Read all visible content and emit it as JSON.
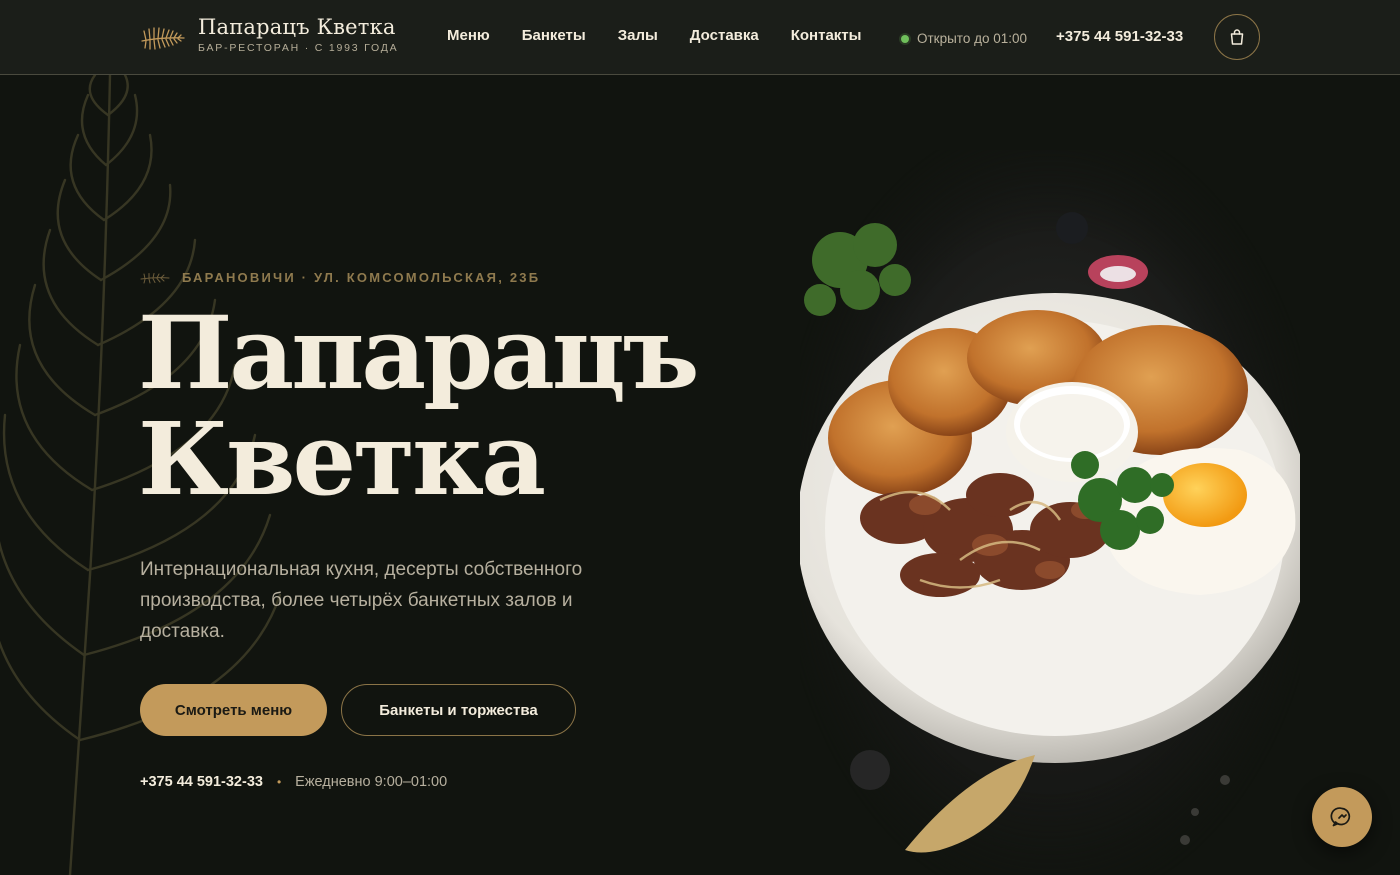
{
  "brand": {
    "name": "Папарацъ Кветка",
    "tagline": "БАР-РЕСТОРАН · С 1993 ГОДА"
  },
  "nav": {
    "items": [
      {
        "label": "Меню"
      },
      {
        "label": "Банкеты"
      },
      {
        "label": "Залы"
      },
      {
        "label": "Доставка"
      },
      {
        "label": "Контакты"
      }
    ]
  },
  "header": {
    "status": "Открыто до 01:00",
    "phone": "+375 44 591-32-33"
  },
  "hero": {
    "eyebrow": "БАРАНОВИЧИ · УЛ. КОМСОМОЛЬСКАЯ, 23Б",
    "title_line1": "Папарацъ",
    "title_line2": "Кветка",
    "description": "Интернациональная кухня, десерты собственного производства, более четырёх банкетных залов и доставка.",
    "primary_button": "Смотреть меню",
    "secondary_button": "Банкеты и торжества",
    "phone": "+375 44 591-32-33",
    "separator": "•",
    "hours": "Ежедневно 9:00–01:00"
  },
  "colors": {
    "background": "#11140f",
    "header": "#1b1e19",
    "accent": "#c39a5b",
    "text": "#f3ecdc",
    "muted": "#b7b09f",
    "status": "#6fbf5b"
  },
  "icons": {
    "logo": "fern-leaf-icon",
    "cart": "shopping-bag-icon",
    "chat": "chat-bubble-icon",
    "image": "food-plate-draniki-photo"
  }
}
